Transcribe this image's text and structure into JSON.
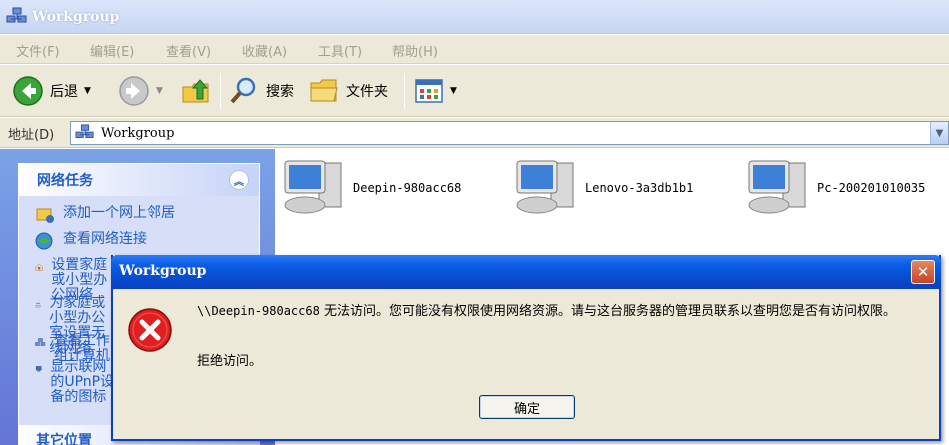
{
  "window": {
    "title": "Workgroup"
  },
  "menu": [
    {
      "label": "文件(F)"
    },
    {
      "label": "编辑(E)"
    },
    {
      "label": "查看(V)"
    },
    {
      "label": "收藏(A)"
    },
    {
      "label": "工具(T)"
    },
    {
      "label": "帮助(H)"
    }
  ],
  "toolbar": {
    "back": "后退",
    "search": "搜索",
    "folders": "文件夹"
  },
  "address": {
    "label": "地址(D)",
    "value": "Workgroup"
  },
  "tasks": {
    "title": "网络任务",
    "items": [
      {
        "label": "添加一个网上邻居"
      },
      {
        "label": "查看网络连接"
      },
      {
        "label": "设置家庭或小型办公网络"
      },
      {
        "label": "为家庭或小型办公室设置无线网络"
      },
      {
        "label": "查看工作组计算机"
      },
      {
        "label": "显示联网的UPnP设备的图标"
      }
    ]
  },
  "other_places": {
    "title": "其它位置"
  },
  "computers": [
    {
      "name": "Deepin-980acc68"
    },
    {
      "name": "Lenovo-3a3db1b1"
    },
    {
      "name": "Pc-200201010035"
    }
  ],
  "dialog": {
    "title": "Workgroup",
    "path": "\\\\Deepin-980acc68",
    "message": " 无法访问。您可能没有权限使用网络资源。请与这台服务器的管理员联系以查明您是否有访问权限。",
    "detail": "拒绝访问。",
    "ok": "确定"
  },
  "colors": {
    "link": "#215dc6",
    "dialog_title": "#0a5ce6",
    "close": "#c84421"
  }
}
